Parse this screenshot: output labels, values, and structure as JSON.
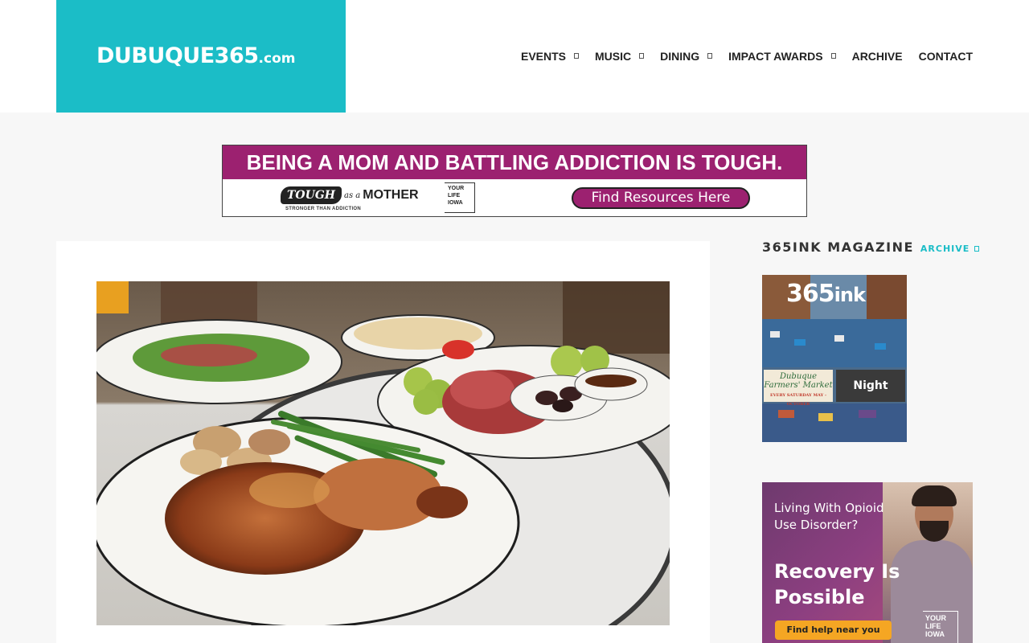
{
  "site": {
    "logo_main": "DUBUQUE365",
    "logo_suffix": ".com"
  },
  "nav": {
    "items": [
      {
        "label": "EVENTS",
        "has_dropdown": true
      },
      {
        "label": "MUSIC",
        "has_dropdown": true
      },
      {
        "label": "DINING",
        "has_dropdown": true
      },
      {
        "label": "IMPACT AWARDS",
        "has_dropdown": true
      },
      {
        "label": "ARCHIVE",
        "has_dropdown": false
      },
      {
        "label": "CONTACT",
        "has_dropdown": false
      }
    ]
  },
  "banner_ad": {
    "headline": "BEING A MOM AND BATTLING ADDICTION IS TOUGH.",
    "brand_tough": "TOUGH",
    "brand_as": "as a",
    "brand_mother": "MOTHER",
    "brand_tagline": "STRONGER THAN ADDICTION",
    "yourlife_logo": "YOUR LIFE IOWA",
    "cta": "Find Resources Here",
    "colors": {
      "primary": "#9c2170"
    }
  },
  "article": {
    "hero_image_icon": "food-plate-photo"
  },
  "sidebar": {
    "title": "365INK MAGAZINE",
    "archive_label": "ARCHIVE",
    "magazine": {
      "masthead": "365",
      "masthead_suffix": "ink",
      "feature_left_line1": "Dubuque",
      "feature_left_line2": "Farmers' Market",
      "feature_left_small": "EVERY SATURDAY MAY - OCTOBER",
      "feature_right": "Night"
    },
    "ad": {
      "question": "Living With Opioid Use Disorder?",
      "headline": "Recovery Is Possible",
      "cta": "Find help near you",
      "brand": "YOUR LIFE IOWA"
    }
  },
  "colors": {
    "accent": "#1bbdc7",
    "page_bg": "#f7f7f7"
  }
}
